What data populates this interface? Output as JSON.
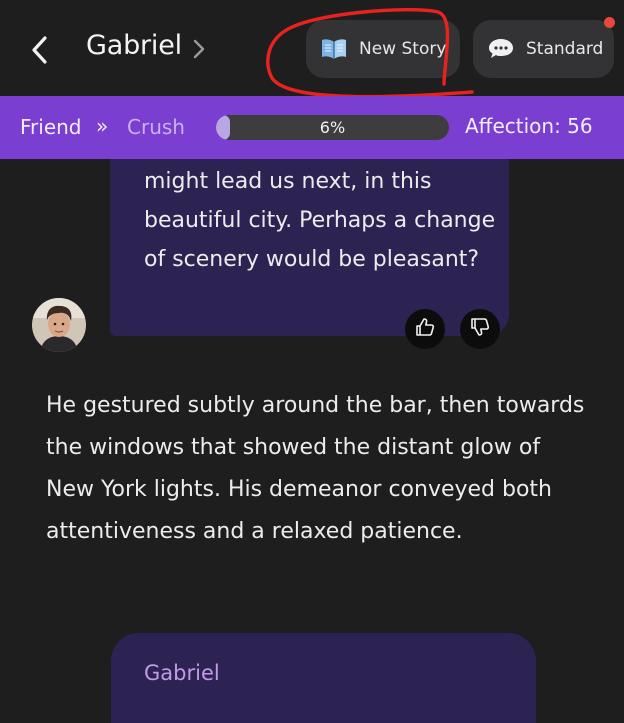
{
  "header": {
    "title": "Gabriel",
    "new_story_label": "New Story",
    "standard_label": "Standard"
  },
  "relationship": {
    "from": "Friend",
    "arrows": "»",
    "to": "Crush",
    "progress_fraction": 0.06,
    "progress_text": "6%",
    "affection_label": "Affection: 56"
  },
  "messages": {
    "bubble_text": "might lead us next, in this beautiful city. Perhaps a change of scenery would be pleasant?",
    "narration": "He gestured subtly around the bar, then towards the windows that showed the distant glow of New York lights. His demeanor conveyed both attentiveness and a relaxed patience.",
    "next_speaker": "Gabriel"
  },
  "colors": {
    "background": "#1e1e1f",
    "accent_bar": "#7a3fd0",
    "bubble": "#2c2352",
    "notification": "#e8473f",
    "annotation_stroke": "#e8231f"
  },
  "icons": [
    "back-chevron-icon",
    "title-chevron-icon",
    "book-icon",
    "chat-bubble-icon",
    "thumbs-up-icon",
    "thumbs-down-icon"
  ]
}
